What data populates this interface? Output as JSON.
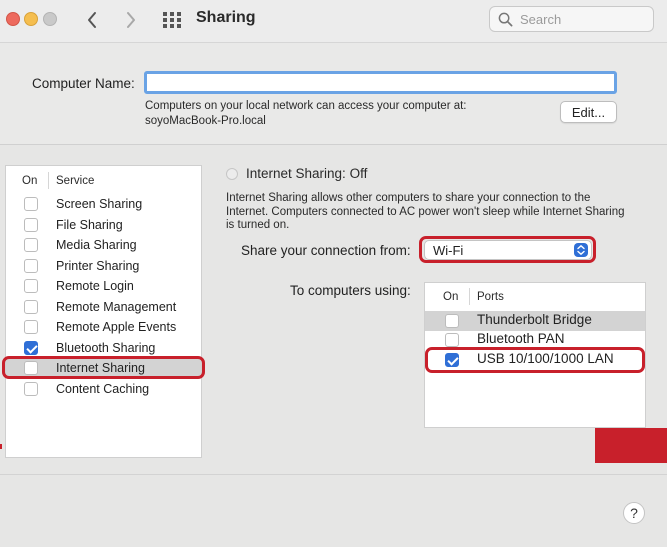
{
  "window": {
    "title": "Sharing"
  },
  "search": {
    "placeholder": "Search"
  },
  "computer_name": {
    "label": "Computer Name:",
    "value": "",
    "note_line1": "Computers on your local network can access your computer at:",
    "note_line2": "soyoMacBook-Pro.local",
    "edit_label": "Edit..."
  },
  "services": {
    "header_on": "On",
    "header_service": "Service",
    "items": [
      {
        "label": "Screen Sharing",
        "checked": false
      },
      {
        "label": "File Sharing",
        "checked": false
      },
      {
        "label": "Media Sharing",
        "checked": false
      },
      {
        "label": "Printer Sharing",
        "checked": false
      },
      {
        "label": "Remote Login",
        "checked": false
      },
      {
        "label": "Remote Management",
        "checked": false
      },
      {
        "label": "Remote Apple Events",
        "checked": false
      },
      {
        "label": "Bluetooth Sharing",
        "checked": true
      },
      {
        "label": "Internet Sharing",
        "checked": false,
        "selected": true
      },
      {
        "label": "Content Caching",
        "checked": false
      }
    ]
  },
  "internet_sharing": {
    "status": "Internet Sharing: Off",
    "description": "Internet Sharing allows other computers to share your connection to the Internet. Computers connected to AC power won't sleep while Internet Sharing is turned on.",
    "share_from_label": "Share your connection from:",
    "share_from_value": "Wi-Fi",
    "to_computers_label": "To computers using:",
    "ports": {
      "header_on": "On",
      "header_ports": "Ports",
      "items": [
        {
          "label": "Thunderbolt Bridge",
          "checked": false,
          "selected": true
        },
        {
          "label": "Bluetooth PAN",
          "checked": false
        },
        {
          "label": "USB 10/100/1000 LAN",
          "checked": true
        }
      ]
    }
  },
  "help": {
    "label": "?"
  },
  "colors": {
    "accent": "#2f6fd6",
    "highlight": "#c8202b",
    "focus_ring": "#6aa3e5"
  }
}
